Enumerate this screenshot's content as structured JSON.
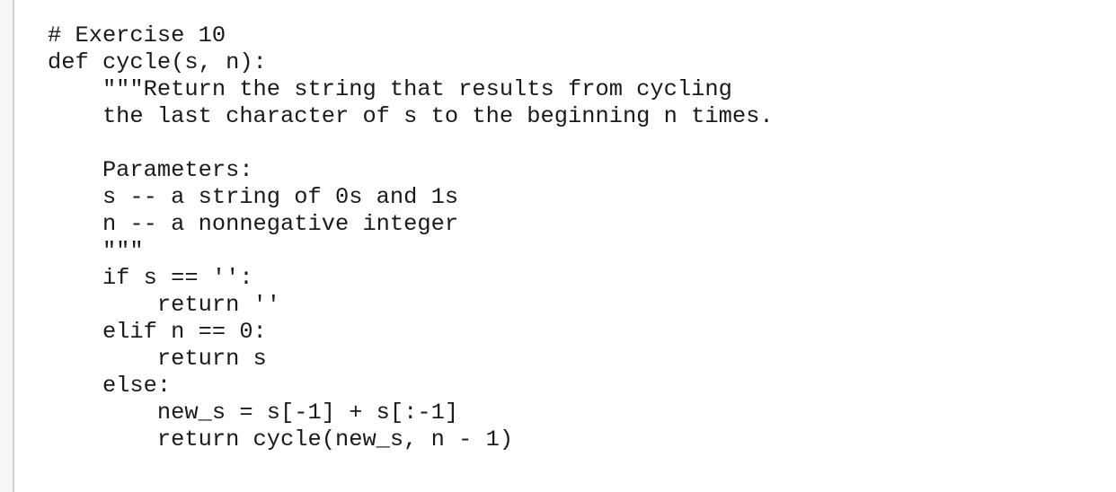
{
  "code_lines": [
    "# Exercise 10",
    "def cycle(s, n):",
    "    \"\"\"Return the string that results from cycling",
    "    the last character of s to the beginning n times.",
    "",
    "    Parameters:",
    "    s -- a string of 0s and 1s",
    "    n -- a nonnegative integer",
    "    \"\"\"",
    "    if s == '':",
    "        return ''",
    "    elif n == 0:",
    "        return s",
    "    else:",
    "        new_s = s[-1] + s[:-1]",
    "        return cycle(new_s, n - 1)"
  ]
}
